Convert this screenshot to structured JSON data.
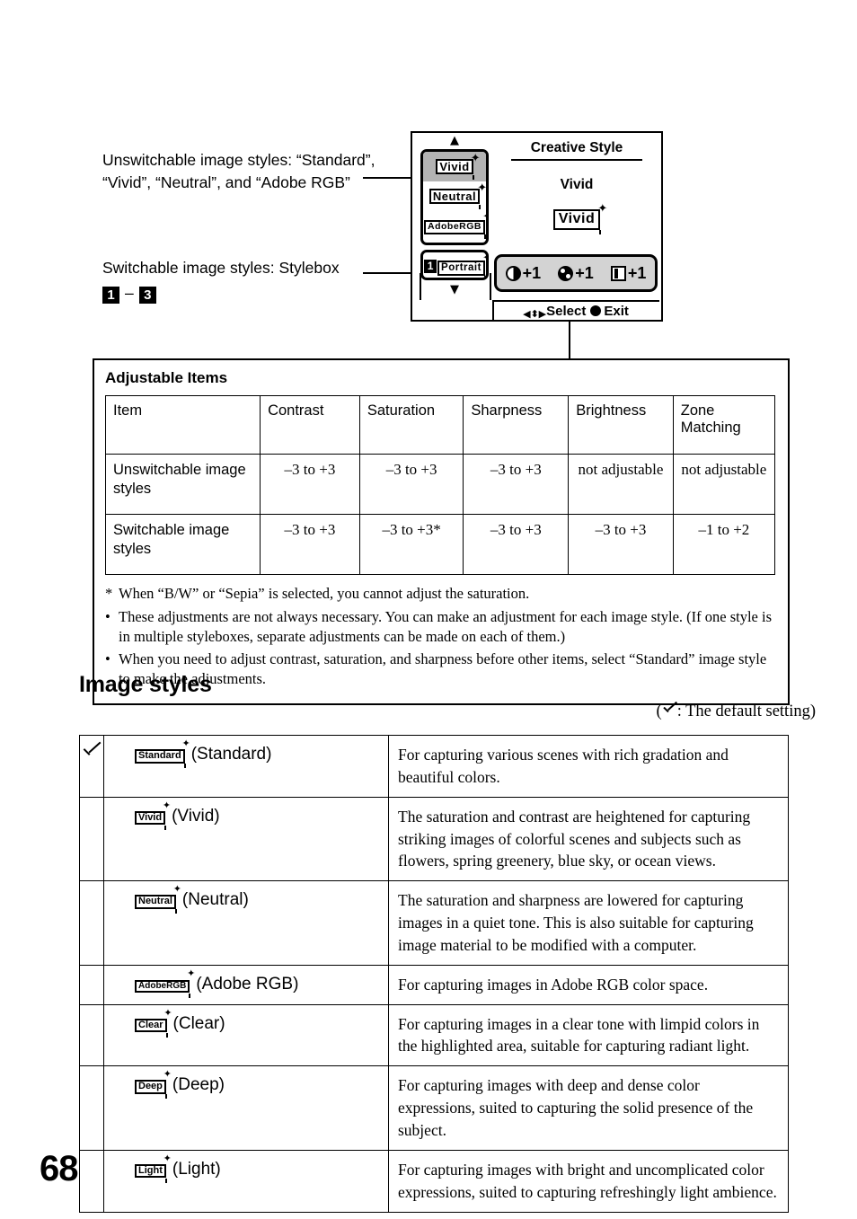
{
  "callouts": {
    "unswitchable": "Unswitchable image styles: “Standard”, “Vivid”, “Neutral”, and “Adobe RGB”",
    "switchable_label": "Switchable image styles: Stylebox",
    "stylebox_from": "1",
    "stylebox_dash": "–",
    "stylebox_to": "3"
  },
  "lcd": {
    "title": "Creative Style",
    "current_name": "Vivid",
    "current_chip": "Vivid",
    "arrow_up": "▲",
    "arrow_down": "▼",
    "style_list": [
      {
        "label": "Vivid",
        "selected": true,
        "numbered": false
      },
      {
        "label": "Neutral",
        "selected": false,
        "numbered": false
      },
      {
        "label": "AdobeRGB",
        "selected": false,
        "numbered": false
      }
    ],
    "style_list_switchable": [
      {
        "number": "1",
        "label": "Portrait",
        "selected": false,
        "numbered": true
      }
    ],
    "adjustments": [
      {
        "icon": "contrast-icon",
        "value": "+1"
      },
      {
        "icon": "saturation-icon",
        "value": "+1"
      },
      {
        "icon": "sharpness-icon",
        "value": "+1"
      }
    ],
    "status": {
      "dpad_icon": "dpad-icon",
      "select_label": "Select",
      "exit_dot_icon": "round-button-icon",
      "exit_label": "Exit"
    }
  },
  "adjustable": {
    "heading": "Adjustable Items",
    "columns": [
      "Item",
      "Contrast",
      "Saturation",
      "Sharpness",
      "Brightness",
      "Zone Matching"
    ],
    "rows": [
      {
        "label": "Unswitchable image styles",
        "values": [
          "–3 to +3",
          "–3 to +3",
          "–3 to +3",
          "not adjustable",
          "not adjustable"
        ]
      },
      {
        "label": "Switchable image styles",
        "values": [
          "–3 to +3",
          "–3 to +3*",
          "–3 to +3",
          "–3 to +3",
          "–1 to +2"
        ]
      }
    ],
    "notes": [
      {
        "mark": "*",
        "text": "When “B/W” or “Sepia” is selected, you cannot adjust the saturation."
      },
      {
        "mark": "•",
        "text": "These adjustments are not always necessary. You can make an adjustment for each image style. (If one style is in multiple styleboxes, separate adjustments can be made on each of them.)"
      },
      {
        "mark": "•",
        "text": "When you need to adjust contrast, saturation, and sharpness before other items, select “Standard” image style to make the adjustments."
      }
    ]
  },
  "image_styles": {
    "heading": "Image styles",
    "default_note_prefix": "(",
    "default_note_text": ": The default setting)",
    "rows": [
      {
        "chip": "Standard",
        "name": "(Standard)",
        "is_default": true,
        "description": "For capturing various scenes with rich gradation and beautiful colors."
      },
      {
        "chip": "Vivid",
        "name": "(Vivid)",
        "is_default": false,
        "description": "The saturation and contrast are heightened for capturing striking images of colorful scenes and subjects such as flowers, spring greenery, blue sky, or ocean views."
      },
      {
        "chip": "Neutral",
        "name": "(Neutral)",
        "is_default": false,
        "description": "The saturation and sharpness are lowered for capturing images in a quiet tone. This is also suitable for capturing image material to be modified with a computer."
      },
      {
        "chip": "AdobeRGB",
        "name": "(Adobe RGB)",
        "is_default": false,
        "description": "For capturing images in Adobe RGB color space."
      },
      {
        "chip": "Clear",
        "name": "(Clear)",
        "is_default": false,
        "description": "For capturing images in a clear tone with limpid colors in the highlighted area, suitable for capturing radiant light."
      },
      {
        "chip": "Deep",
        "name": "(Deep)",
        "is_default": false,
        "description": "For capturing images with deep and dense color expressions, suited to capturing the solid presence of the subject."
      },
      {
        "chip": "Light",
        "name": "(Light)",
        "is_default": false,
        "description": "For capturing images with bright and uncomplicated color expressions, suited to capturing refreshingly light ambience."
      }
    ]
  },
  "page_number": "68",
  "colors": {
    "ink": "#000000",
    "paper": "#ffffff",
    "lcd_highlight": "#b3b3b3",
    "lcd_adjbar": "#d3d3d3"
  }
}
